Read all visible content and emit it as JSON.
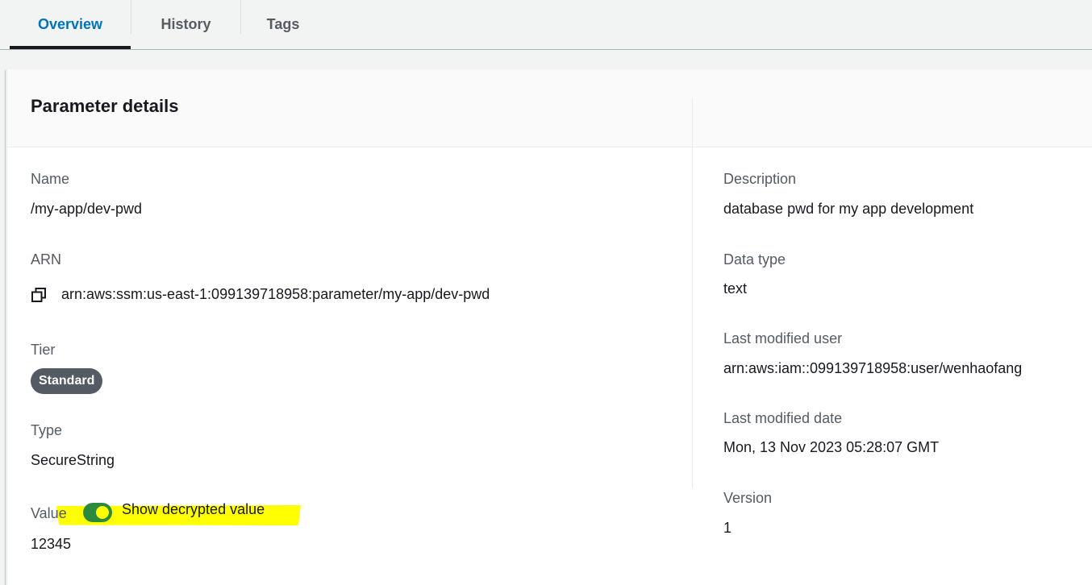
{
  "tabs": [
    {
      "label": "Overview",
      "active": true
    },
    {
      "label": "History",
      "active": false
    },
    {
      "label": "Tags",
      "active": false
    }
  ],
  "card": {
    "title": "Parameter details"
  },
  "left": {
    "name_label": "Name",
    "name_value": "/my-app/dev-pwd",
    "arn_label": "ARN",
    "arn_value": "arn:aws:ssm:us-east-1:099139718958:parameter/my-app/dev-pwd",
    "tier_label": "Tier",
    "tier_value": "Standard",
    "type_label": "Type",
    "type_value": "SecureString",
    "value_label": "Value",
    "toggle_label": "Show decrypted value",
    "toggle_on": true,
    "value_value": "12345"
  },
  "right": {
    "description_label": "Description",
    "description_value": "database pwd for my app development",
    "datatype_label": "Data type",
    "datatype_value": "text",
    "modified_user_label": "Last modified user",
    "modified_user_value": "arn:aws:iam::099139718958:user/wenhaofang",
    "modified_date_label": "Last modified date",
    "modified_date_value": "Mon, 13 Nov 2023 05:28:07 GMT",
    "version_label": "Version",
    "version_value": "1"
  },
  "colors": {
    "accent": "#0073bb",
    "toggle_on": "#2b8a3e",
    "highlight": "#ffff00",
    "badge": "#545b64"
  },
  "icons": {
    "copy": "copy-icon"
  }
}
